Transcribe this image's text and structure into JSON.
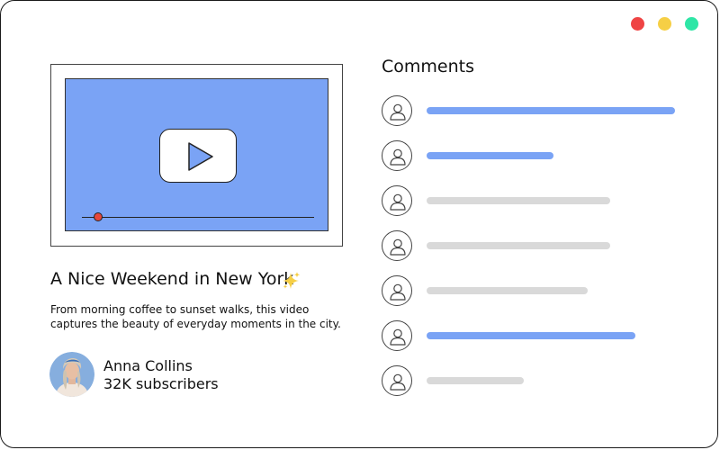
{
  "window": {
    "controls": [
      {
        "name": "close",
        "color": "#ef4444"
      },
      {
        "name": "minimize",
        "color": "#f6cf45"
      },
      {
        "name": "maximize",
        "color": "#2ee6a6"
      }
    ]
  },
  "video": {
    "title": "A Nice Weekend in New York",
    "title_emoji_icon": "sparkles-icon",
    "description": "From morning coffee to sunset walks, this video captures the beauty of everyday moments in the city.",
    "screen_color": "#7aa3f5",
    "knob_color": "#e8473b",
    "progress": 0.07
  },
  "channel": {
    "name": "Anna Collins",
    "subscribers": "32K subscribers",
    "avatar_icon": "user-photo-avatar"
  },
  "comments": {
    "title": "Comments",
    "items": [
      {
        "length": 1.0,
        "color": "#7aa3f5"
      },
      {
        "length": 0.51,
        "color": "#7aa3f5"
      },
      {
        "length": 0.74,
        "color": "#d9d9d9"
      },
      {
        "length": 0.74,
        "color": "#d9d9d9"
      },
      {
        "length": 0.65,
        "color": "#d9d9d9"
      },
      {
        "length": 0.84,
        "color": "#7aa3f5"
      },
      {
        "length": 0.39,
        "color": "#d9d9d9"
      }
    ]
  }
}
